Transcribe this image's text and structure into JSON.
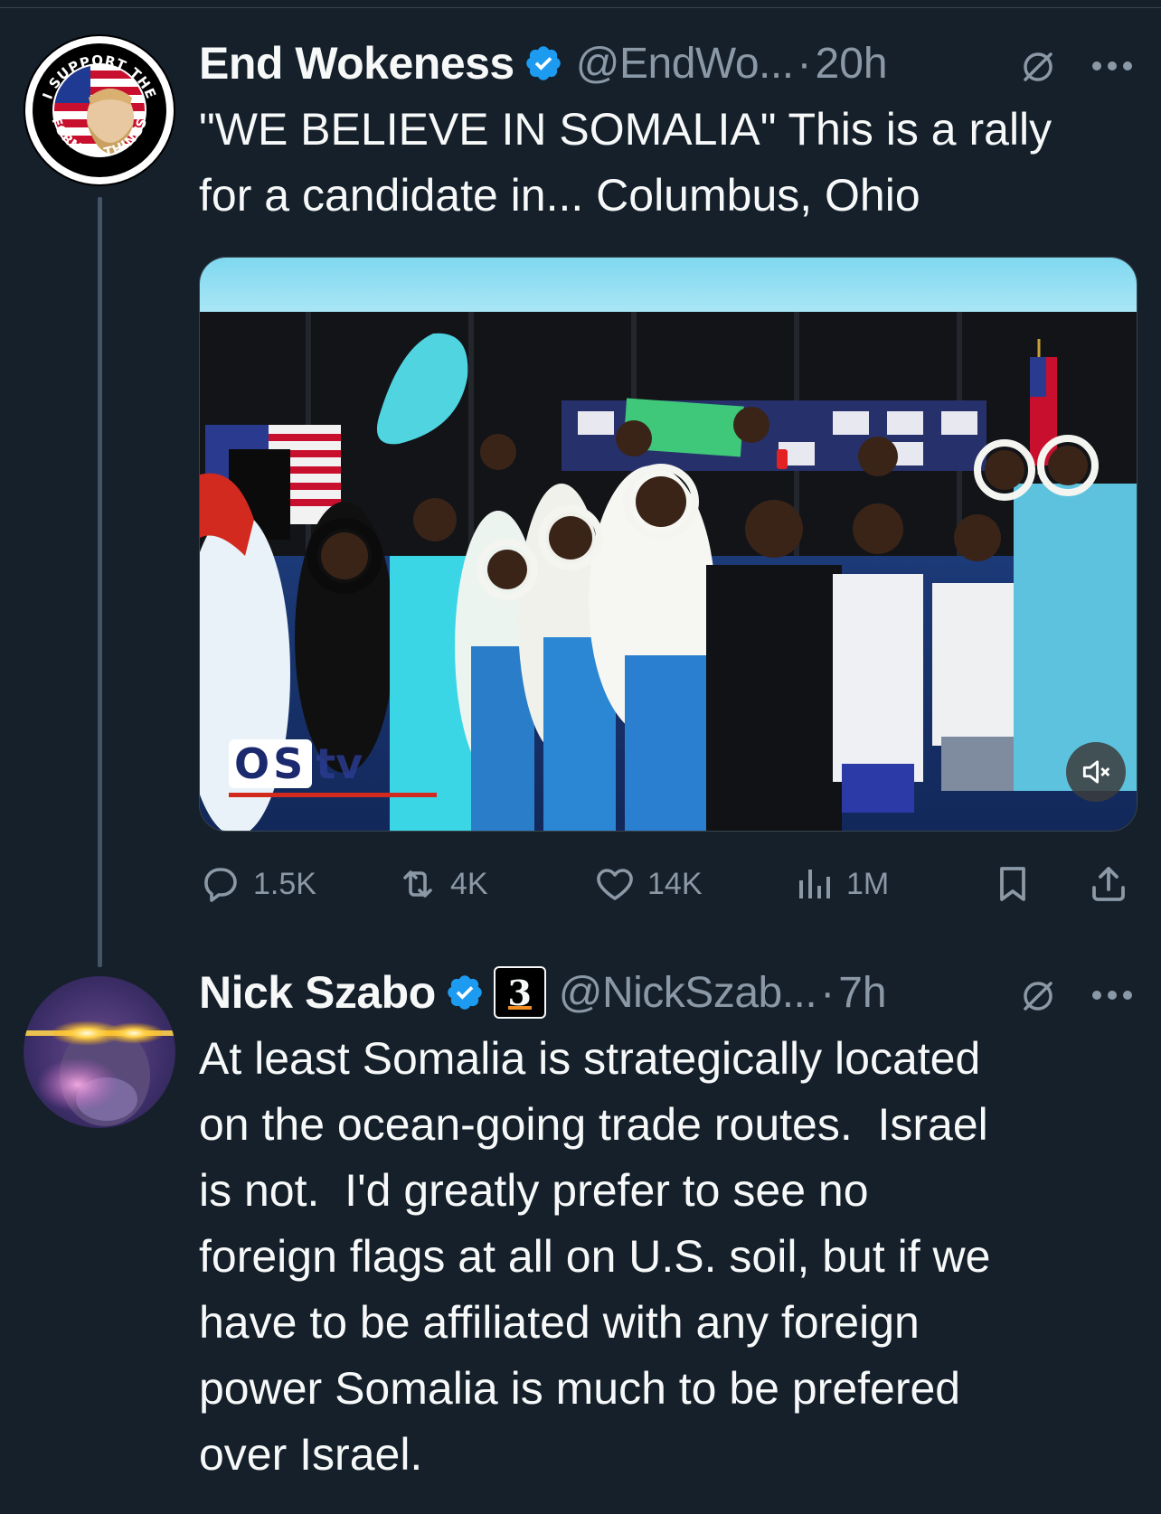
{
  "tweets": [
    {
      "display_name": "End Wokeness",
      "handle": "@EndWo...",
      "dot": "·",
      "time": "20h",
      "text": "\"WE BELIEVE IN SOMALIA\" This is a rally\nfor a candidate in... Columbus, Ohio",
      "avatar": {
        "top_text": "I SUPPORT THE",
        "bottom_text": "FORMER THINGS"
      },
      "media": {
        "kind": "video",
        "watermark": "OS",
        "watermark_suffix": "tv",
        "muted_icon": "speaker-muted-icon"
      },
      "actions": {
        "replies": "1.5K",
        "reposts": "4K",
        "likes": "14K",
        "views": "1M"
      }
    },
    {
      "display_name": "Nick Szabo",
      "handle": "@NickSzab...",
      "dot": "·",
      "time": "7h",
      "affiliate_badge": "3",
      "text": "At least Somalia is strategically located\non the ocean-going trade routes.  Israel\nis not.  I'd greatly prefer to see no\nforeign flags at all on U.S. soil, but if we\nhave to be affiliated with any foreign\npower Somalia is much to be prefered\nover Israel."
    }
  ],
  "icons": {
    "verified": "verified-badge-icon",
    "grok": "grok-icon",
    "more": "more-options-icon",
    "reply": "reply-icon",
    "repost": "repost-icon",
    "like": "heart-icon",
    "views": "views-chart-icon",
    "bookmark": "bookmark-icon",
    "share": "share-icon"
  },
  "colors": {
    "background": "#15202b",
    "text": "#f7f9f9",
    "secondary": "#8b98a5",
    "verified": "#1d9bf0",
    "thread_line": "#425466"
  }
}
